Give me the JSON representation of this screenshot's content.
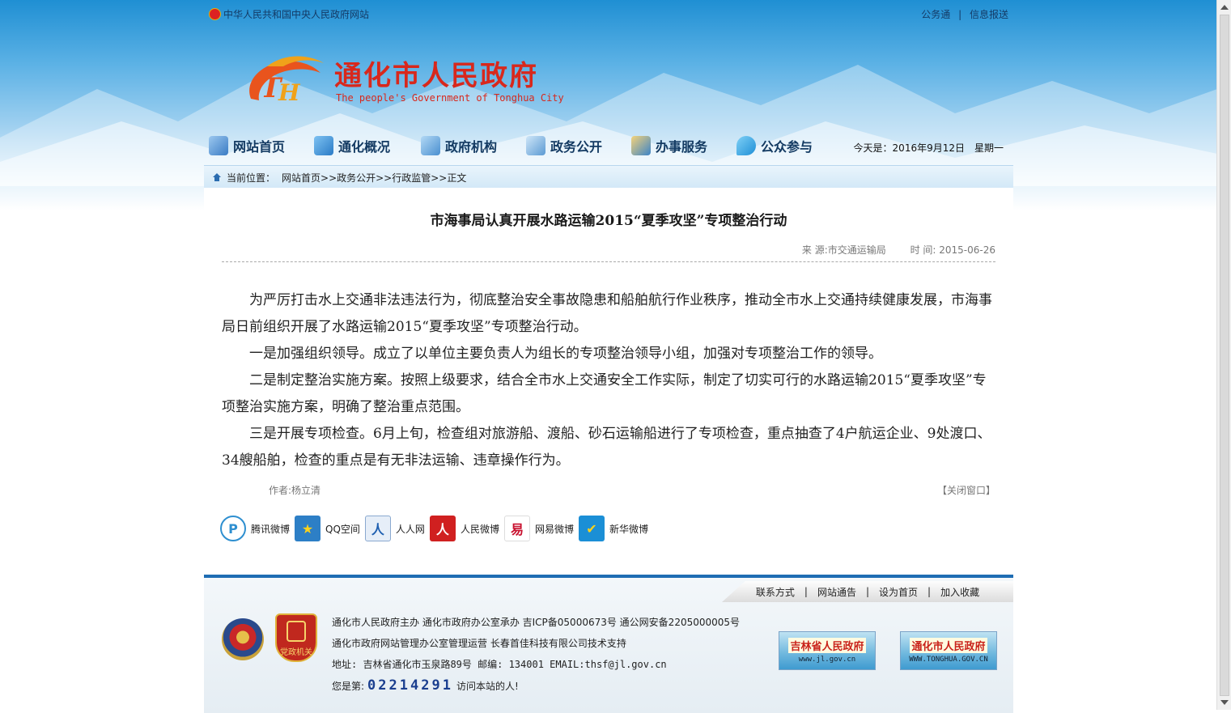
{
  "topbar": {
    "gov_link": "中华人民共和国中央人民政府网站",
    "link1": "公务通",
    "sep": "|",
    "link2": "信息报送"
  },
  "logo": {
    "title": "通化市人民政府",
    "subtitle": "The people's Government of Tonghua City",
    "mark_letters": "TH"
  },
  "nav": {
    "items": [
      {
        "label": "网站首页",
        "icon": "home-icon"
      },
      {
        "label": "通化概况",
        "icon": "overview-icon"
      },
      {
        "label": "政府机构",
        "icon": "institution-icon"
      },
      {
        "label": "政务公开",
        "icon": "document-icon"
      },
      {
        "label": "办事服务",
        "icon": "service-icon"
      },
      {
        "label": "公众参与",
        "icon": "chat-icon"
      }
    ],
    "date": "今天是：2016年9月12日　星期一"
  },
  "breadcrumb": {
    "prefix": "当前位置：",
    "path": "网站首页>>政务公开>>行政监管>>正文"
  },
  "article": {
    "title": "市海事局认真开展水路运输2015“夏季攻坚”专项整治行动",
    "source": "来  源:市交通运输局",
    "time": "时  间: 2015-06-26",
    "paragraphs": [
      "为严厉打击水上交通非法违法行为，彻底整治安全事故隐患和船舶航行作业秩序，推动全市水上交通持续健康发展，市海事局日前组织开展了水路运输2015“夏季攻坚”专项整治行动。",
      "一是加强组织领导。成立了以单位主要负责人为组长的专项整治领导小组，加强对专项整治工作的领导。",
      "二是制定整治实施方案。按照上级要求，结合全市水上交通安全工作实际，制定了切实可行的水路运输2015“夏季攻坚”专项整治实施方案，明确了整治重点范围。",
      "三是开展专项检查。6月上旬，检查组对旅游船、渡船、砂石运输船进行了专项检查，重点抽查了4户航运企业、9处渡口、34艘船舶，检查的重点是有无非法运输、违章操作行为。"
    ],
    "author": "作者:杨立清",
    "close": "【关闭窗口】"
  },
  "share": [
    {
      "label": "腾讯微博",
      "icon": "tencent-weibo-icon",
      "color": "#2e8fd0",
      "glyph": "P"
    },
    {
      "label": "QQ空间",
      "icon": "qzone-icon",
      "color": "#2d7fc6",
      "glyph": "★"
    },
    {
      "label": "人人网",
      "icon": "renren-icon",
      "color": "#1e5fb0",
      "glyph": "人"
    },
    {
      "label": "人民微博",
      "icon": "people-weibo-icon",
      "color": "#d02020",
      "glyph": "人"
    },
    {
      "label": "网易微博",
      "icon": "netease-weibo-icon",
      "color": "#c8102e",
      "glyph": "易"
    },
    {
      "label": "新华微博",
      "icon": "xinhua-weibo-icon",
      "color": "#1b8fd6",
      "glyph": "✔"
    }
  ],
  "footer": {
    "links": [
      "联系方式",
      "网站通告",
      "设为首页",
      "加入收藏"
    ],
    "sep": "|",
    "party_badge": "党政机关",
    "line1": "通化市人民政府主办 通化市政府办公室承办 吉ICP备05000673号 通公网安备2205000005号",
    "line2": "通化市政府网站管理办公室管理运营 长春首佳科技有限公司技术支持",
    "line3": "地址: 吉林省通化市玉泉路89号 邮编: 134001 EMAIL:thsf@jl.gov.cn",
    "visitor_prefix": "您是第:",
    "visitor_count": "02214291",
    "visitor_suffix": "访问本站的人!",
    "banner1_title": "吉林省人民政府",
    "banner1_url": "www.jl.gov.cn",
    "banner2_title": "通化市人民政府",
    "banner2_url": "WWW.TONGHUA.GOV.CN"
  }
}
